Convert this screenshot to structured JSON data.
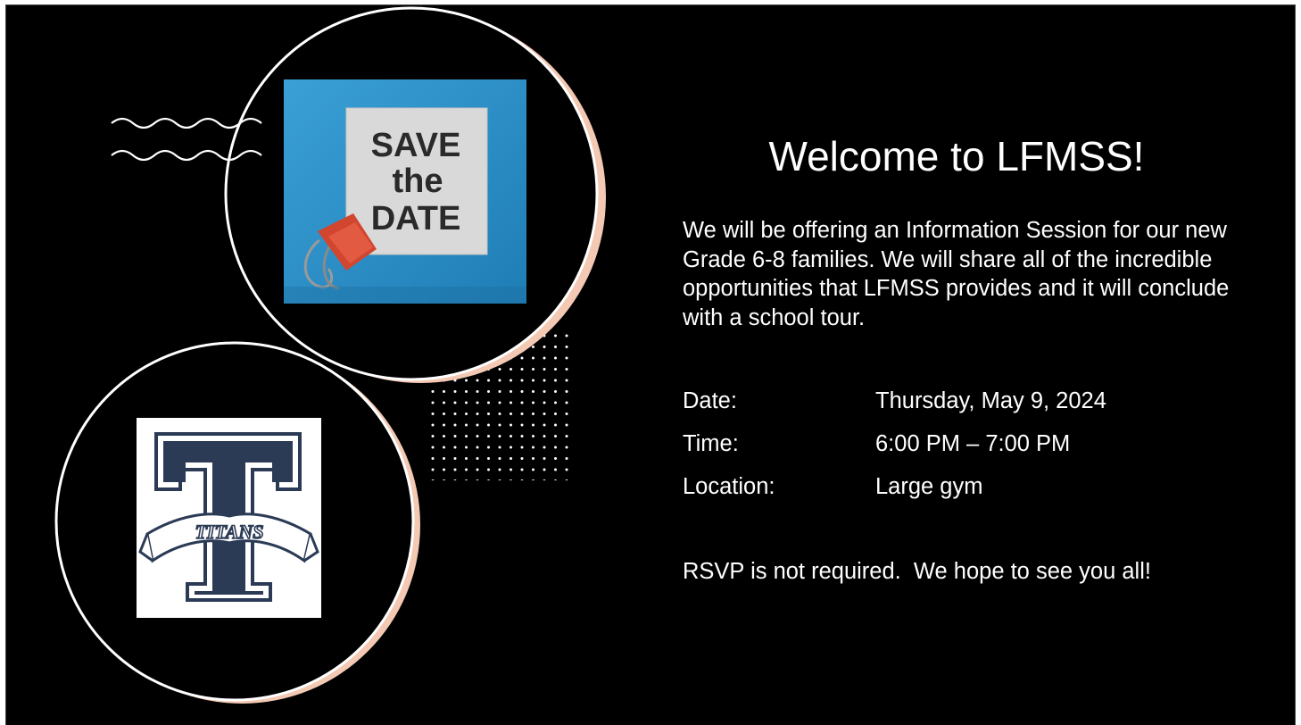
{
  "slide": {
    "title": "Welcome to LFMSS!",
    "intro": "We will be offering an Information Session for our new Grade 6-8 families. We will share all of the incredible opportunities that LFMSS provides and it will conclude with a school tour.",
    "details": [
      {
        "label": "Date:",
        "value": "Thursday, May 9, 2024"
      },
      {
        "label": "Time:",
        "value": "6:00 PM – 7:00 PM"
      },
      {
        "label": "Location:",
        "value": "Large gym"
      }
    ],
    "rsvp": "RSVP is not required.  We hope to see you all!"
  },
  "save_the_date_image": {
    "lines": [
      "SAVE",
      "the",
      "DATE"
    ]
  },
  "titans_logo": {
    "banner_text": "TITANS"
  },
  "colors": {
    "background": "#000000",
    "text": "#ffffff",
    "circle_shadow": "#f4c9b4",
    "photo_blue": "#2e8fc8",
    "clip_red": "#d2452f",
    "logo_navy": "#2b3a55"
  }
}
